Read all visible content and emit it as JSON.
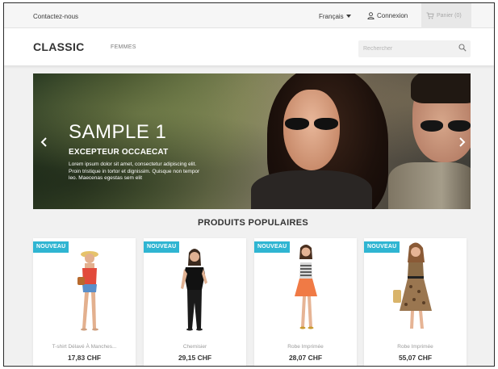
{
  "topnav": {
    "contact": "Contactez-nous",
    "language": "Français",
    "login": "Connexion",
    "cart": "Panier (0)"
  },
  "header": {
    "logo": "CLASSIC",
    "menu": [
      "FEMMES"
    ],
    "search_placeholder": "Rechercher"
  },
  "slider": {
    "title": "SAMPLE 1",
    "subtitle": "EXCEPTEUR OCCAECAT",
    "text": "Lorem ipsum dolor sit amet, consectetur adipiscing elit. Proin tristique in tortor et dignissim. Quisque non tempor leo. Maecenas egestas sem elit"
  },
  "section_title": "PRODUITS POPULAIRES",
  "products": [
    {
      "badge": "NOUVEAU",
      "name": "T-shirt Délavé À Manches...",
      "price": "17,83 CHF"
    },
    {
      "badge": "NOUVEAU",
      "name": "Chemisier",
      "price": "29,15 CHF"
    },
    {
      "badge": "NOUVEAU",
      "name": "Robe Imprimée",
      "price": "28,07 CHF"
    },
    {
      "badge": "NOUVEAU",
      "name": "Robe Imprimée",
      "price": "55,07 CHF"
    }
  ],
  "colors": {
    "accent": "#2fb5d2",
    "text": "#333333",
    "background": "#f1f1f1"
  },
  "icons": {
    "login": "user-icon",
    "cart": "cart-icon",
    "search": "search-icon",
    "prev": "chevron-left-icon",
    "next": "chevron-right-icon"
  }
}
